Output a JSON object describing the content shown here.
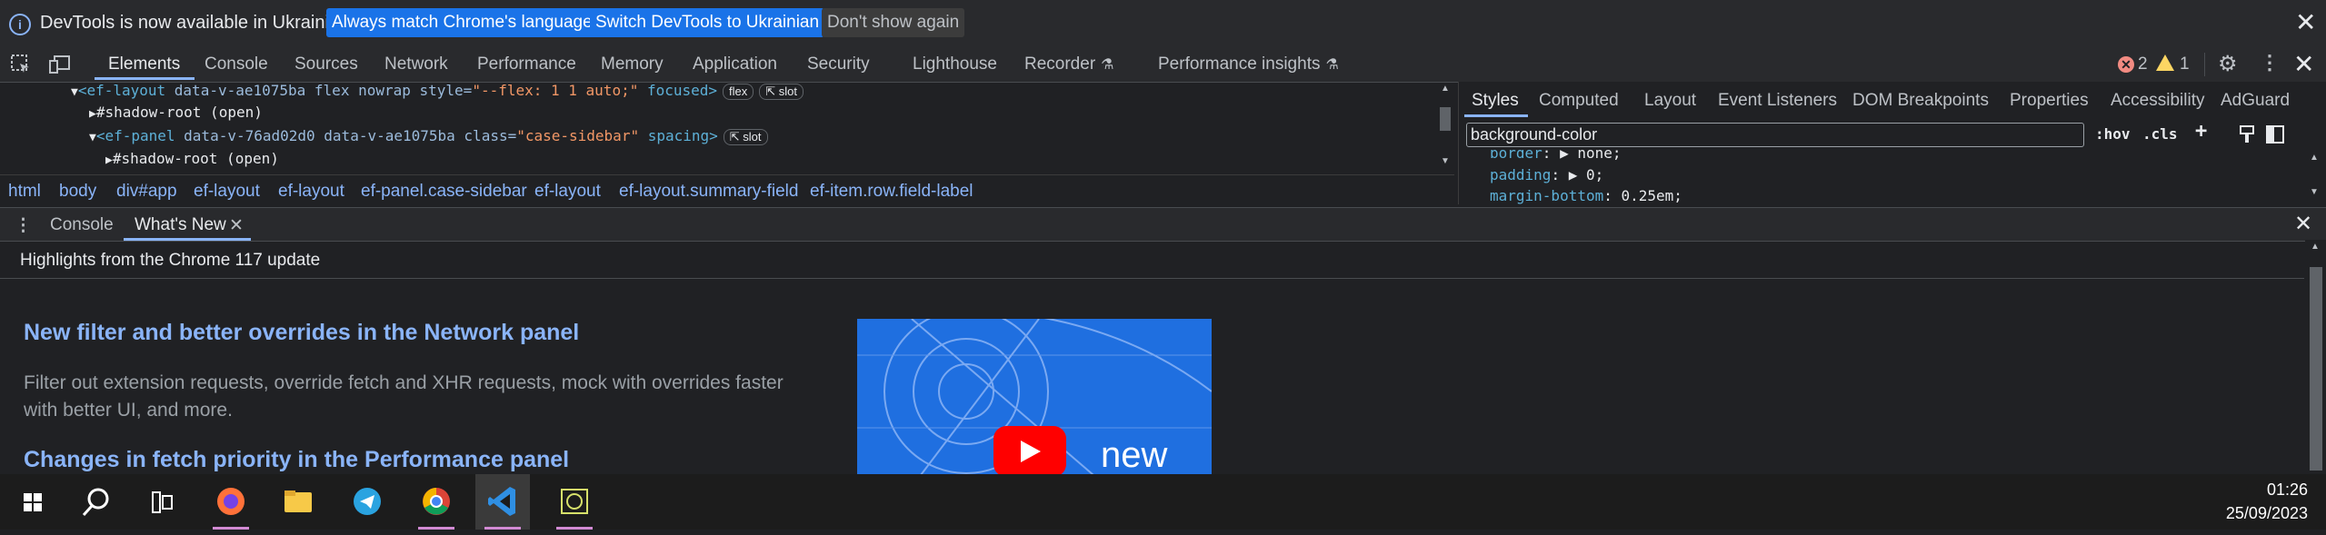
{
  "infobar": {
    "message": "DevTools is now available in Ukrainian!",
    "btn_match": "Always match Chrome's language",
    "btn_switch": "Switch DevTools to Ukrainian",
    "btn_dont_show": "Don't show again"
  },
  "toolbar": {
    "tabs": [
      "Elements",
      "Console",
      "Sources",
      "Network",
      "Performance",
      "Memory",
      "Application",
      "Security",
      "Lighthouse",
      "Recorder",
      "Performance insights"
    ],
    "active_tab": "Elements",
    "error_count": "2",
    "warning_count": "1"
  },
  "tree": {
    "line1": {
      "tag": "<ef-layout",
      "attrs": " data-v-ae1075ba flex nowrap ",
      "style_attr": "style=",
      "style_val": "\"--flex: 1 1 auto;\"",
      "rest": " focused>",
      "pill1": "flex",
      "pill2": "slot"
    },
    "line2": "#shadow-root (open)",
    "line3": {
      "tag": "<ef-panel",
      "attrs": " data-v-76ad02d0 data-v-ae1075ba ",
      "class_attr": "class=",
      "class_val": "\"case-sidebar\"",
      "rest": " spacing>",
      "pill": "slot"
    },
    "line4": "#shadow-root (open)"
  },
  "breadcrumbs": [
    "html",
    "body",
    "div#app",
    "ef-layout",
    "ef-layout",
    "ef-panel.case-sidebar",
    "ef-layout",
    "ef-layout.summary-field",
    "ef-item.row.field-label"
  ],
  "styles": {
    "tabs": [
      "Styles",
      "Computed",
      "Layout",
      "Event Listeners",
      "DOM Breakpoints",
      "Properties",
      "Accessibility",
      "AdGuard"
    ],
    "filter_value": "background-color",
    "hov": ":hov",
    "cls": ".cls",
    "props": [
      {
        "name": "border",
        "value": "none;"
      },
      {
        "name": "padding",
        "value": "0;"
      },
      {
        "name": "margin-bottom",
        "value": "0.25em;"
      }
    ]
  },
  "drawer": {
    "tabs": [
      "Console",
      "What's New"
    ],
    "active_tab": "What's New",
    "header": "Highlights from the Chrome 117 update",
    "heading1": "New filter and better overrides in the Network panel",
    "para1": "Filter out extension requests, override fetch and XHR requests, mock with overrides faster with better UI, and more.",
    "heading2": "Changes in fetch priority in the Performance panel",
    "video_label": "new"
  },
  "taskbar": {
    "apps": [
      "start-icon",
      "search-icon",
      "task-view-icon",
      "firefox-icon",
      "file-explorer-icon",
      "telegram-icon",
      "chrome-icon",
      "vscode-icon",
      "app-icon"
    ],
    "time": "01:26",
    "date": "25/09/2023"
  },
  "colors": {
    "accent": "#8ab4f8",
    "primary_btn": "#1a73e8",
    "bg": "#202124"
  }
}
